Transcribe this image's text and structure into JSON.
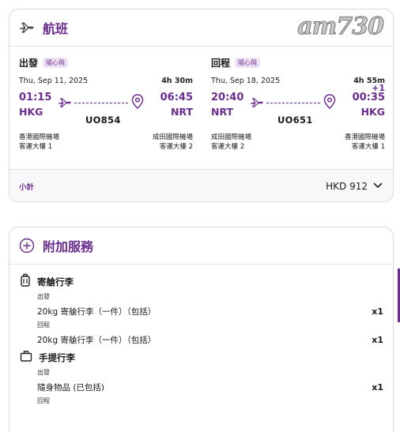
{
  "flights": {
    "title": "航班",
    "watermark": "am730",
    "outbound": {
      "label": "出發",
      "tag": "隨心飛",
      "date": "Thu, Sep 11, 2025",
      "duration": "4h 30m",
      "dep_time": "01:15",
      "arr_time": "06:45",
      "dep_airport": "HKG",
      "arr_airport": "NRT",
      "flight_no": "UO854",
      "dep_name": "香港國際機場",
      "dep_terminal": "客運大樓 1",
      "arr_name": "成田國際機場",
      "arr_terminal": "客運大樓 2"
    },
    "return": {
      "label": "回程",
      "tag": "隨心飛",
      "date": "Thu, Sep 18, 2025",
      "duration": "4h 55m",
      "dep_time": "20:40",
      "arr_time": "00:35",
      "day_offset": "+1",
      "dep_airport": "NRT",
      "arr_airport": "HKG",
      "flight_no": "UO651",
      "dep_name": "成田國際機場",
      "dep_terminal": "客運大樓 2",
      "arr_name": "香港國際機場",
      "arr_terminal": "客運大樓 1"
    },
    "subtotal_label": "小計",
    "subtotal_amount": "HKD 912"
  },
  "services": {
    "title": "附加服務",
    "checked": {
      "title": "寄艙行李",
      "out_label": "出發",
      "out_item": "20kg 寄艙行李（一件）（包括）",
      "out_qty": "x1",
      "ret_label": "回程",
      "ret_item": "20kg 寄艙行李（一件）（包括）",
      "ret_qty": "x1"
    },
    "carry": {
      "title": "手提行李",
      "out_label": "出發",
      "out_item": "隨身物品 (已包括)",
      "out_qty": "x1",
      "ret_label": "回程"
    }
  },
  "colors": {
    "accent": "#6b2c8f",
    "tag_bg": "#efe4f5",
    "border": "#d9d9de"
  }
}
